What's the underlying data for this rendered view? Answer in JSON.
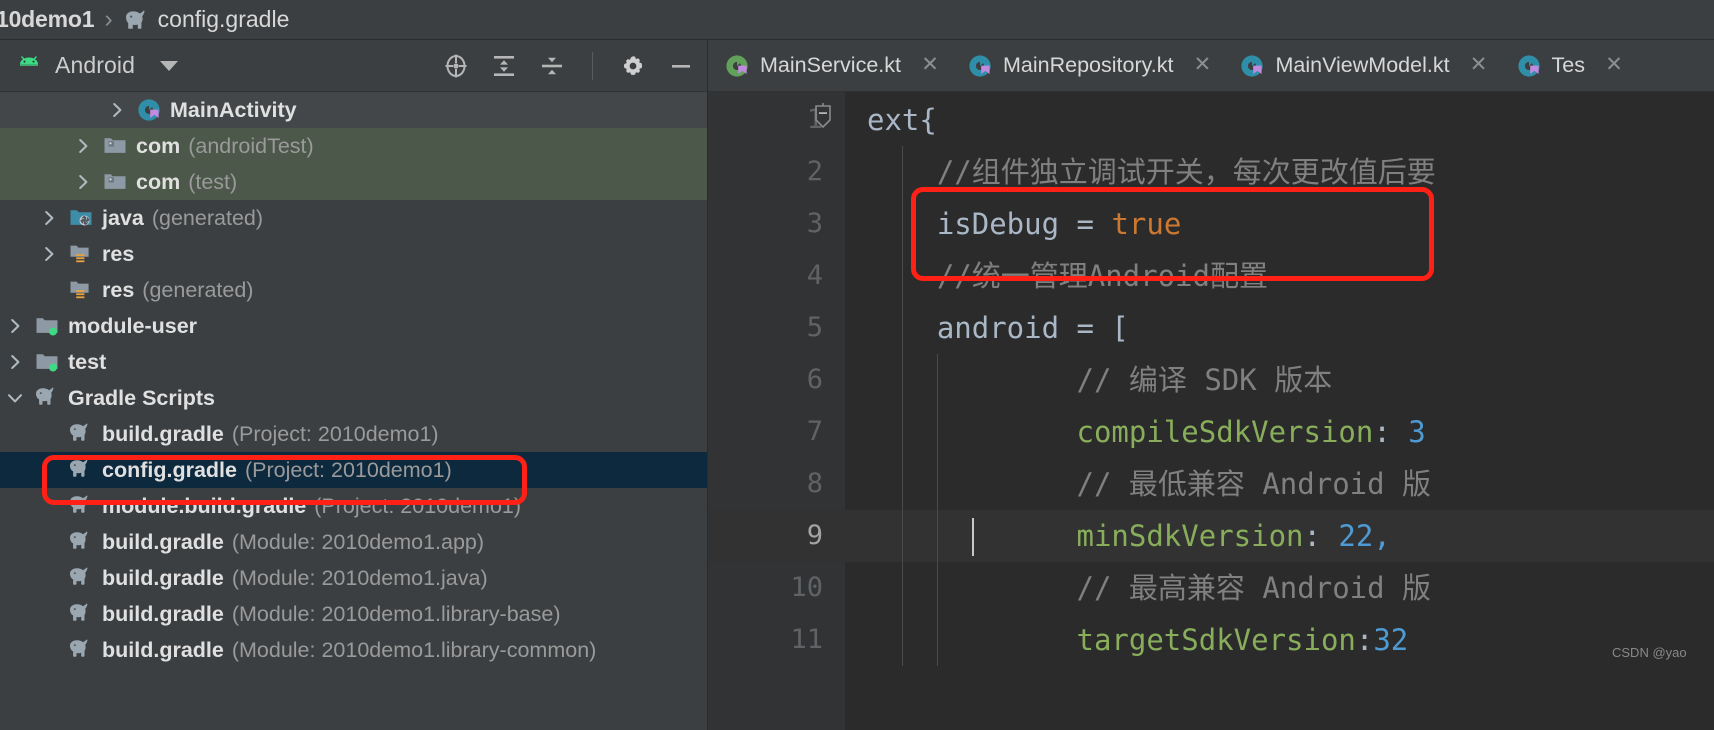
{
  "breadcrumb": {
    "project": "10demo1",
    "separator": "›",
    "file": "config.gradle",
    "file_icon": "gradle-elephant-icon"
  },
  "project_panel": {
    "title": "Android",
    "title_icon": "android-robot-icon",
    "dropdown_icon": "chevron-down-icon",
    "toolbar": [
      {
        "name": "select-opened-file-icon",
        "label": "Select Opened File"
      },
      {
        "name": "expand-all-icon",
        "label": "Expand All"
      },
      {
        "name": "collapse-all-icon",
        "label": "Collapse All"
      },
      {
        "name": "settings-gear-icon",
        "label": "Settings"
      },
      {
        "name": "hide-panel-icon",
        "label": "Hide"
      }
    ],
    "tree": [
      {
        "indent": 3,
        "chevron": "right",
        "icon": "kotlin-class-icon",
        "name": "MainActivity",
        "sub": "",
        "state": "hover"
      },
      {
        "indent": 2,
        "chevron": "right",
        "icon": "folder-package-icon",
        "name": "com",
        "sub": "(androidTest)",
        "state": "highlight-green"
      },
      {
        "indent": 2,
        "chevron": "right",
        "icon": "folder-package-icon",
        "name": "com",
        "sub": "(test)",
        "state": "highlight-green"
      },
      {
        "indent": 1,
        "chevron": "right",
        "icon": "folder-java-generated-icon",
        "name": "java",
        "sub": "(generated)",
        "state": "none"
      },
      {
        "indent": 1,
        "chevron": "right",
        "icon": "folder-res-icon",
        "name": "res",
        "sub": "",
        "state": "none"
      },
      {
        "indent": 1,
        "chevron": "none",
        "icon": "folder-res-icon",
        "name": "res",
        "sub": "(generated)",
        "state": "none"
      },
      {
        "indent": 0,
        "chevron": "right",
        "icon": "folder-module-icon",
        "name": "module-user",
        "sub": "",
        "state": "none"
      },
      {
        "indent": 0,
        "chevron": "right",
        "icon": "folder-module-icon",
        "name": "test",
        "sub": "",
        "state": "none"
      },
      {
        "indent": 0,
        "chevron": "down",
        "icon": "gradle-elephant-icon",
        "name": "Gradle Scripts",
        "sub": "",
        "state": "none"
      },
      {
        "indent": 1,
        "chevron": "none",
        "icon": "gradle-elephant-icon",
        "name": "build.gradle",
        "sub": "(Project: 2010demo1)",
        "state": "none"
      },
      {
        "indent": 1,
        "chevron": "none",
        "icon": "gradle-elephant-icon",
        "name": "config.gradle",
        "sub": "(Project: 2010demo1)",
        "state": "selected"
      },
      {
        "indent": 1,
        "chevron": "none",
        "icon": "gradle-elephant-icon",
        "name": "module.build.gradle",
        "sub": "(Project: 2010demo1)",
        "state": "none"
      },
      {
        "indent": 1,
        "chevron": "none",
        "icon": "gradle-elephant-icon",
        "name": "build.gradle",
        "sub": "(Module: 2010demo1.app)",
        "state": "none"
      },
      {
        "indent": 1,
        "chevron": "none",
        "icon": "gradle-elephant-icon",
        "name": "build.gradle",
        "sub": "(Module: 2010demo1.java)",
        "state": "none"
      },
      {
        "indent": 1,
        "chevron": "none",
        "icon": "gradle-elephant-icon",
        "name": "build.gradle",
        "sub": "(Module: 2010demo1.library-base)",
        "state": "none"
      },
      {
        "indent": 1,
        "chevron": "none",
        "icon": "gradle-elephant-icon",
        "name": "build.gradle",
        "sub": "(Module: 2010demo1.library-common)",
        "state": "none"
      }
    ]
  },
  "editor": {
    "tabs": [
      {
        "label": "MainService.kt",
        "icon": "kotlin-file-icon",
        "icon_color": "#61a15a",
        "close_icon": "close-icon",
        "active": false
      },
      {
        "label": "MainRepository.kt",
        "icon": "kotlin-file-icon",
        "icon_color": "#2f8fa8",
        "close_icon": "close-icon",
        "active": false
      },
      {
        "label": "MainViewModel.kt",
        "icon": "kotlin-file-icon",
        "icon_color": "#2f8fa8",
        "close_icon": "close-icon",
        "active": false
      },
      {
        "label": "Tes",
        "icon": "kotlin-file-icon",
        "icon_color": "#2f8fa8",
        "close_icon": "close-icon",
        "active": false
      }
    ],
    "current_line": 9,
    "lines": [
      {
        "num": "1",
        "segments": [
          {
            "t": "ext{",
            "c": "cp"
          }
        ],
        "fold": true
      },
      {
        "num": "2",
        "segments": [
          {
            "t": "    //组件独立调试开关，每次更改值后要",
            "c": "cm"
          }
        ]
      },
      {
        "num": "3",
        "segments": [
          {
            "t": "    isDebug = ",
            "c": "cp"
          },
          {
            "t": "true",
            "c": "ck"
          }
        ]
      },
      {
        "num": "4",
        "segments": [
          {
            "t": "    //统一管理Android配置",
            "c": "cm"
          }
        ]
      },
      {
        "num": "5",
        "segments": [
          {
            "t": "    android = [",
            "c": "cp"
          }
        ]
      },
      {
        "num": "6",
        "segments": [
          {
            "t": "            // 编译 SDK 版本",
            "c": "cm"
          }
        ]
      },
      {
        "num": "7",
        "segments": [
          {
            "t": "            compileSdkVersion",
            "c": "cid"
          },
          {
            "t": ": ",
            "c": "cop"
          },
          {
            "t": "3",
            "c": "cn"
          }
        ]
      },
      {
        "num": "8",
        "segments": [
          {
            "t": "            // 最低兼容 Android 版",
            "c": "cm"
          }
        ]
      },
      {
        "num": "9",
        "segments": [
          {
            "t": "            minSdkVersion",
            "c": "cid"
          },
          {
            "t": ": ",
            "c": "cop"
          },
          {
            "t": "22,",
            "c": "cn"
          }
        ]
      },
      {
        "num": "10",
        "segments": [
          {
            "t": "            // 最高兼容 Android 版",
            "c": "cm"
          }
        ]
      },
      {
        "num": "11",
        "segments": [
          {
            "t": "            targetSdkVersion",
            "c": "cid"
          },
          {
            "t": ":",
            "c": "cop"
          },
          {
            "t": "32",
            "c": "cn"
          }
        ]
      }
    ]
  },
  "annotations": [
    {
      "name": "highlight-config-gradle-row",
      "color": "#ff2116"
    },
    {
      "name": "highlight-isdebug-line",
      "color": "#ff2116"
    }
  ],
  "watermark": {
    "text": "CSDN @yao"
  },
  "colors": {
    "panel_bg": "#3c3f41",
    "editor_bg": "#2b2b2b",
    "gutter_bg": "#313335",
    "selection_blue": "#0d293e",
    "highlight_green": "#4c5849",
    "annotation_red": "#ff2116",
    "accent_green": "#3ddc84"
  }
}
